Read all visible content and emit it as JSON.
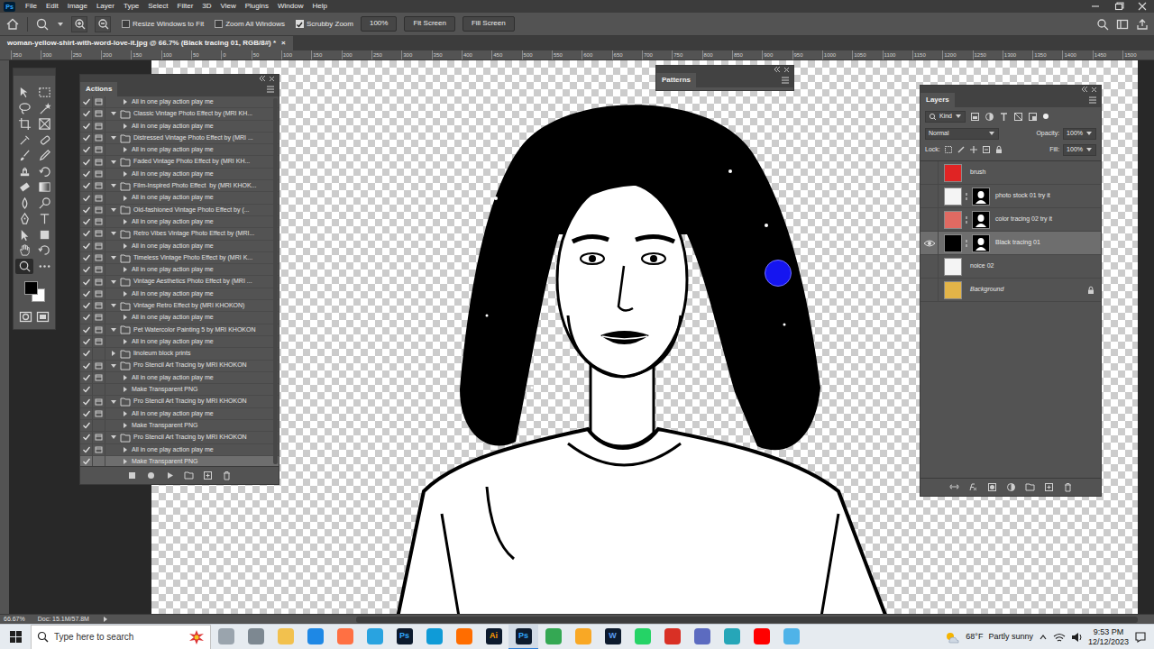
{
  "app": {
    "logo": "Ps"
  },
  "menu": [
    "File",
    "Edit",
    "Image",
    "Layer",
    "Type",
    "Select",
    "Filter",
    "3D",
    "View",
    "Plugins",
    "Window",
    "Help"
  ],
  "options_bar": {
    "checkboxes": [
      {
        "label": "Resize Windows to Fit",
        "checked": false
      },
      {
        "label": "Zoom All Windows",
        "checked": false
      },
      {
        "label": "Scrubby Zoom",
        "checked": true
      }
    ],
    "buttons": [
      "100%",
      "Fit Screen",
      "Fill Screen"
    ]
  },
  "document": {
    "title": "woman-yellow-shirt-with-word-love-it.jpg @ 66.7% (Black tracing 01, RGB/8#) *",
    "close": "×"
  },
  "ruler": [
    "350",
    "300",
    "250",
    "200",
    "150",
    "100",
    "50",
    "0",
    "50",
    "100",
    "150",
    "200",
    "250",
    "300",
    "350",
    "400",
    "450",
    "500",
    "550",
    "600",
    "650",
    "700",
    "750",
    "800",
    "850",
    "900",
    "950",
    "1000",
    "1050",
    "1100",
    "1150",
    "1200",
    "1250",
    "1300",
    "1350",
    "1400",
    "1450",
    "1500"
  ],
  "toolbar": {
    "tools": [
      {
        "selected": false
      },
      {
        "selected": false
      },
      {
        "selected": false
      },
      {
        "selected": false
      },
      {
        "selected": false
      },
      {
        "selected": false
      },
      {
        "selected": false
      },
      {
        "selected": false
      },
      {
        "selected": false
      },
      {
        "selected": false
      },
      {
        "selected": false
      },
      {
        "selected": false
      },
      {
        "selected": false
      },
      {
        "selected": false
      },
      {
        "selected": false
      },
      {
        "selected": false
      },
      {
        "selected": false
      },
      {
        "selected": false
      },
      {
        "selected": false
      },
      {
        "selected": false
      },
      {
        "selected": false
      },
      {
        "selected": false
      },
      {
        "selected": true
      },
      {
        "selected": false
      }
    ],
    "foreground": "#000000",
    "background": "#ffffff"
  },
  "actions": {
    "title": "Actions",
    "rows": [
      {
        "label": "All in one play action play me",
        "kind": "action",
        "checked": true,
        "dialog": true,
        "expanded": false,
        "selected": false
      },
      {
        "label": "Classic Vintage Photo Effect by (MRI KH...",
        "kind": "set",
        "checked": true,
        "dialog": true,
        "expanded": true,
        "selected": false
      },
      {
        "label": "All in one play action play me",
        "kind": "action",
        "checked": true,
        "dialog": true,
        "expanded": false,
        "selected": false
      },
      {
        "label": "Distressed Vintage Photo Effect by (MRI ...",
        "kind": "set",
        "checked": true,
        "dialog": true,
        "expanded": true,
        "selected": false
      },
      {
        "label": "All in one play action play me",
        "kind": "action",
        "checked": true,
        "dialog": true,
        "expanded": false,
        "selected": false
      },
      {
        "label": "Faded Vintage Photo Effect by (MRI KH...",
        "kind": "set",
        "checked": true,
        "dialog": true,
        "expanded": true,
        "selected": false
      },
      {
        "label": "All in one play action play me",
        "kind": "action",
        "checked": true,
        "dialog": true,
        "expanded": false,
        "selected": false
      },
      {
        "label": "Film-Inspired Photo Effect  by (MRI KHOK...",
        "kind": "set",
        "checked": true,
        "dialog": true,
        "expanded": true,
        "selected": false
      },
      {
        "label": "All in one play action play me",
        "kind": "action",
        "checked": true,
        "dialog": true,
        "expanded": false,
        "selected": false
      },
      {
        "label": "Old-fashioned Vintage Photo Effect by (...",
        "kind": "set",
        "checked": true,
        "dialog": true,
        "expanded": true,
        "selected": false
      },
      {
        "label": "All in one play action play me",
        "kind": "action",
        "checked": true,
        "dialog": true,
        "expanded": false,
        "selected": false
      },
      {
        "label": "Retro Vibes Vintage Photo Effect by (MRI...",
        "kind": "set",
        "checked": true,
        "dialog": true,
        "expanded": true,
        "selected": false
      },
      {
        "label": "All in one play action play me",
        "kind": "action",
        "checked": true,
        "dialog": true,
        "expanded": false,
        "selected": false
      },
      {
        "label": "Timeless Vintage Photo Effect by (MRI K...",
        "kind": "set",
        "checked": true,
        "dialog": true,
        "expanded": true,
        "selected": false
      },
      {
        "label": "All in one play action play me",
        "kind": "action",
        "checked": true,
        "dialog": true,
        "expanded": false,
        "selected": false
      },
      {
        "label": "Vintage Aesthetics Photo Effect by (MRI ...",
        "kind": "set",
        "checked": true,
        "dialog": true,
        "expanded": true,
        "selected": false
      },
      {
        "label": "All in one play action play me",
        "kind": "action",
        "checked": true,
        "dialog": true,
        "expanded": false,
        "selected": false
      },
      {
        "label": "Vintage Retro Effect by (MRI KHOKON)",
        "kind": "set",
        "checked": true,
        "dialog": true,
        "expanded": true,
        "selected": false
      },
      {
        "label": "All in one play action play me",
        "kind": "action",
        "checked": true,
        "dialog": true,
        "expanded": false,
        "selected": false
      },
      {
        "label": "Pet Watercolor Painting 5 by MRI KHOKON",
        "kind": "set",
        "checked": true,
        "dialog": true,
        "expanded": true,
        "selected": false
      },
      {
        "label": "All in one play action play me",
        "kind": "action",
        "checked": true,
        "dialog": true,
        "expanded": false,
        "selected": false
      },
      {
        "label": "linoleum block prints",
        "kind": "set",
        "checked": true,
        "dialog": false,
        "expanded": false,
        "selected": false
      },
      {
        "label": "Pro Stencil Art Tracing by MRI KHOKON",
        "kind": "set",
        "checked": true,
        "dialog": true,
        "expanded": true,
        "selected": false
      },
      {
        "label": "All in one play action play me",
        "kind": "action",
        "checked": true,
        "dialog": true,
        "expanded": false,
        "selected": false
      },
      {
        "label": "Make Transparent PNG",
        "kind": "action",
        "checked": true,
        "dialog": false,
        "expanded": false,
        "selected": false
      },
      {
        "label": "Pro Stencil Art Tracing by MRI KHOKON",
        "kind": "set",
        "checked": true,
        "dialog": true,
        "expanded": true,
        "selected": false
      },
      {
        "label": "All in one play action play me",
        "kind": "action",
        "checked": true,
        "dialog": true,
        "expanded": false,
        "selected": false
      },
      {
        "label": "Make Transparent PNG",
        "kind": "action",
        "checked": true,
        "dialog": false,
        "expanded": false,
        "selected": false
      },
      {
        "label": "Pro Stencil Art Tracing by MRI KHOKON",
        "kind": "set",
        "checked": true,
        "dialog": true,
        "expanded": true,
        "selected": false
      },
      {
        "label": "All in one play action play me",
        "kind": "action",
        "checked": true,
        "dialog": true,
        "expanded": false,
        "selected": false
      },
      {
        "label": "Make Transparent PNG",
        "kind": "action",
        "checked": true,
        "dialog": false,
        "expanded": false,
        "selected": true
      }
    ]
  },
  "patterns": {
    "title": "Patterns"
  },
  "layers": {
    "title": "Layers",
    "filter": "Kind",
    "blend_mode": "Normal",
    "opacity_label": "Opacity:",
    "opacity": "100%",
    "lock_label": "Lock:",
    "fill_label": "Fill:",
    "fill": "100%",
    "rows": [
      {
        "name": "brush",
        "visible": false,
        "color": "#e02424",
        "mask": false,
        "locked": false,
        "selected": false
      },
      {
        "name": "photo stock 01 try it",
        "visible": false,
        "color": "#f4f4f4",
        "mask": true,
        "locked": false,
        "selected": false
      },
      {
        "name": "color tracing 02 try it",
        "visible": false,
        "color": "#e06a62",
        "mask": true,
        "locked": false,
        "selected": false
      },
      {
        "name": "Black tracing 01",
        "visible": true,
        "color": "#000000",
        "mask": true,
        "locked": false,
        "selected": true
      },
      {
        "name": "noice 02",
        "visible": false,
        "color": "#f4f4f4",
        "mask": false,
        "locked": false,
        "selected": false
      },
      {
        "name": "Background",
        "visible": false,
        "color": "#e3b448",
        "mask": false,
        "locked": true,
        "selected": false
      }
    ]
  },
  "status_bar": {
    "zoom": "66.67%",
    "doc": "Doc: 15.1M/57.8M"
  },
  "taskbar": {
    "search_placeholder": "Type here to search",
    "apps": [
      {
        "kind": "tile",
        "color": "#9aa4ad",
        "active": false
      },
      {
        "kind": "tile",
        "color": "#7d8891",
        "active": false
      },
      {
        "kind": "tile",
        "color": "#f2c14e",
        "active": false
      },
      {
        "kind": "tile",
        "color": "#1e88e5",
        "active": false
      },
      {
        "kind": "tile",
        "color": "#ff7043",
        "active": false
      },
      {
        "kind": "tile",
        "color": "#29a3e0",
        "active": false
      },
      {
        "kind": "letter",
        "label": "Ps",
        "color": "#31a8ff",
        "active": false
      },
      {
        "kind": "tile",
        "color": "#0f9bd7",
        "active": false
      },
      {
        "kind": "tile",
        "color": "#ff6d00",
        "active": false
      },
      {
        "kind": "letter",
        "label": "Ai",
        "color": "#ff9a00",
        "active": false
      },
      {
        "kind": "letter",
        "label": "Ps",
        "color": "#31a8ff",
        "active": true
      },
      {
        "kind": "tile",
        "color": "#34a853",
        "active": false
      },
      {
        "kind": "tile",
        "color": "#f9a825",
        "active": false
      },
      {
        "kind": "letter",
        "label": "W",
        "color": "#5b9bf0",
        "active": false
      },
      {
        "kind": "tile",
        "color": "#25d366",
        "active": false
      },
      {
        "kind": "tile",
        "color": "#d93025",
        "active": false
      },
      {
        "kind": "tile",
        "color": "#5c6bc0",
        "active": false
      },
      {
        "kind": "tile",
        "color": "#26a6b8",
        "active": false
      },
      {
        "kind": "tile",
        "color": "#ff0000",
        "active": false
      },
      {
        "kind": "tile",
        "color": "#4fb3e8",
        "active": false
      }
    ],
    "weather": {
      "temp": "68°F",
      "text": "Partly sunny"
    },
    "time": "9:53 PM",
    "date": "12/12/2023"
  }
}
